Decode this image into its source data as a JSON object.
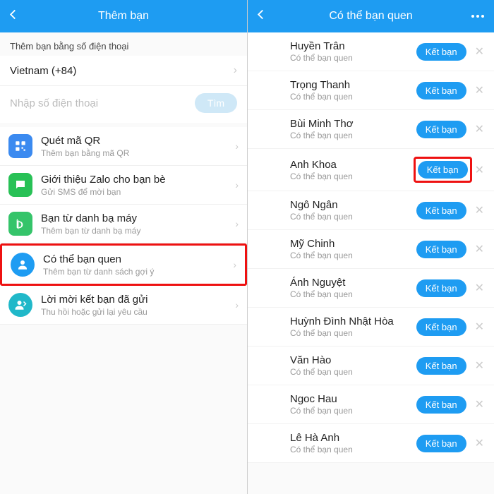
{
  "left": {
    "header_title": "Thêm bạn",
    "section_label": "Thêm bạn bằng số điện thoại",
    "country": "Vietnam (+84)",
    "phone_placeholder": "Nhập số điện thoại",
    "find_label": "Tìm",
    "menu": [
      {
        "title": "Quét mã QR",
        "sub": "Thêm bạn bằng mã QR"
      },
      {
        "title": "Giới thiệu Zalo cho bạn bè",
        "sub": "Gửi SMS để mời bạn"
      },
      {
        "title": "Bạn từ danh bạ máy",
        "sub": "Thêm bạn từ danh bạ máy"
      },
      {
        "title": "Có thể bạn quen",
        "sub": "Thêm bạn từ danh sách gợi ý"
      },
      {
        "title": "Lời mời kết bạn đã gửi",
        "sub": "Thu hồi hoặc gửi lại yêu cầu"
      }
    ]
  },
  "right": {
    "header_title": "Có thể bạn quen",
    "sub_label": "Có thể bạn quen",
    "add_label": "Kết bạn",
    "contacts": [
      {
        "name": "Huyền Trân"
      },
      {
        "name": "Trọng Thanh"
      },
      {
        "name": "Bùi Minh Thơ"
      },
      {
        "name": "Anh Khoa"
      },
      {
        "name": "Ngô Ngân"
      },
      {
        "name": "Mỹ Chinh"
      },
      {
        "name": "Ánh Nguyệt"
      },
      {
        "name": "Huỳnh Đình Nhật Hòa"
      },
      {
        "name": "Văn Hào"
      },
      {
        "name": "Ngoc Hau"
      },
      {
        "name": "Lê Hà Anh"
      }
    ],
    "highlight_index": 3
  }
}
